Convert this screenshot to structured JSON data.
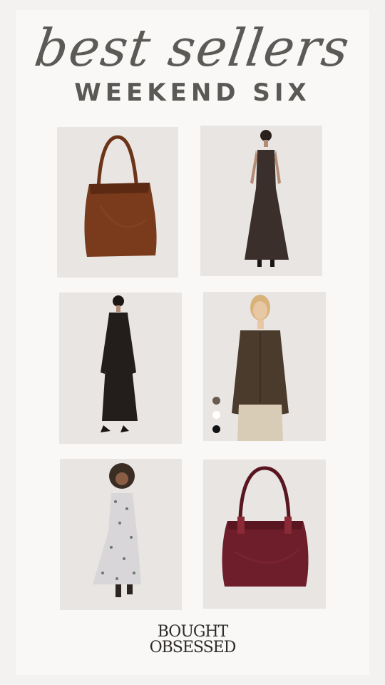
{
  "header": {
    "title": "best sellers",
    "subtitle": "WEEKEND SIX"
  },
  "products": [
    {
      "name": "brown suede tote bag",
      "icon": "tote-bag"
    },
    {
      "name": "dark sleeveless maxi dress",
      "icon": "dress"
    },
    {
      "name": "black long sleeve maxi dress",
      "icon": "dress"
    },
    {
      "name": "brown knit cardigan",
      "icon": "cardigan"
    },
    {
      "name": "floral print midi dress",
      "icon": "dress"
    },
    {
      "name": "burgundy leather handbag",
      "icon": "handbag"
    }
  ],
  "swatch_colors": [
    "#6b5a4e",
    "#ffffff",
    "#111111"
  ],
  "colors": {
    "background": "#f4f2f1",
    "card": "#f9f8f7",
    "tile": "#e8e5e3",
    "title": "#5b5a57"
  },
  "logo": {
    "line1": "BOUGHT",
    "line2": "OBSESSED"
  }
}
